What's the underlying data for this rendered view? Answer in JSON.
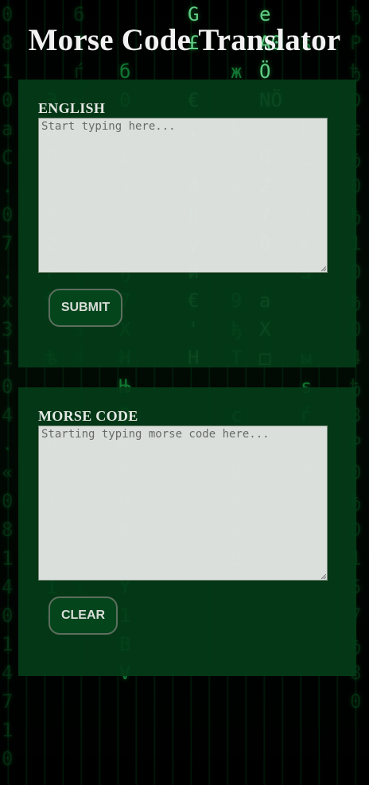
{
  "header": {
    "title": "Morse Code Translator"
  },
  "english_panel": {
    "label": "ENGLISH",
    "input_placeholder": "Start typing here...",
    "input_value": "",
    "button_label": "SUBMIT"
  },
  "morse_panel": {
    "label": "MORSE CODE",
    "input_placeholder": "Starting typing morse code here...",
    "input_value": "",
    "button_label": "CLEAR"
  },
  "colors": {
    "panel_background": "#033c18",
    "page_background": "#000000",
    "matrix_green": "#1fd35a"
  }
}
